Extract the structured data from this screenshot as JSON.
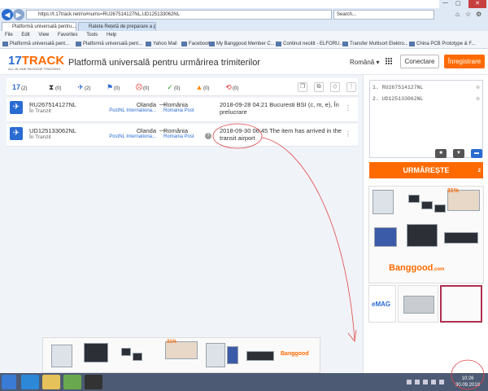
{
  "browser": {
    "url": "https://t.17track.net/ro#nums=RU267514127NL,UD125133062NL",
    "search_placeholder": "Search...",
    "tabs": [
      "Platformă universală pentru...",
      "Rateta Rețetă de preparare a pa..."
    ],
    "menu": [
      "File",
      "Edit",
      "View",
      "Favorites",
      "Tools",
      "Help"
    ],
    "favorites": [
      "Platformă universală pent...",
      "Platformă universală pent...",
      "Yahoo Mail",
      "Facebook",
      "My Banggood Member C...",
      "Continut necitit - ELFORU...",
      "Transfer Multisort Elektro...",
      "China PCB Prototype & F..."
    ]
  },
  "header": {
    "logo_text": "17",
    "logo_text2": "TRACK",
    "logo_sub": "ALL-IN-ONE PACKAGE TRACKING",
    "title": "Platformă universală pentru urmărirea trimiterilor",
    "language": "Română ▾",
    "login": "Conectare",
    "register": "Înregistrare"
  },
  "filters": [
    {
      "icon": "17",
      "count": "(2)",
      "color": "#2a6bd1"
    },
    {
      "icon": "⧗",
      "count": "(0)",
      "color": "#666666"
    },
    {
      "icon": "✈",
      "count": "(2)",
      "color": "#2a6bd1"
    },
    {
      "icon": "⚑",
      "count": "(0)",
      "color": "#2a6bd1"
    },
    {
      "icon": "☹",
      "count": "(0)",
      "color": "#e03030"
    },
    {
      "icon": "✓",
      "count": "(0)",
      "color": "#2aa02a"
    },
    {
      "icon": "▲",
      "count": "(0)",
      "color": "#ff8a00"
    },
    {
      "icon": "⟲",
      "count": "(0)",
      "color": "#e03030"
    }
  ],
  "tools": [
    "copy-icon",
    "copy-alt-icon",
    "refresh-icon",
    "more-icon"
  ],
  "packages": [
    {
      "number": "RU267514127NL",
      "status": "În Tranzit",
      "from_country": "Olanda",
      "from_carrier": "PostNL Internationa...",
      "to_country": "România",
      "to_carrier": "Romania Post",
      "event": "2018-09-28 04:21  Bucuresti BSI (c, m, e), În prelucrare"
    },
    {
      "number": "UD125133062NL",
      "status": "În Tranzit",
      "from_country": "Olanda",
      "from_carrier": "PostNL Internationa...",
      "to_country": "România",
      "to_carrier": "Romania Post",
      "event": "2018-09-30 06:45  The item has arrived in the transit airport"
    }
  ],
  "track_panel": {
    "lines": [
      "1.  RU267514127NL",
      "2.  UD125133062NL"
    ],
    "button": "URMĂREȘTE",
    "count": "2"
  },
  "ads": {
    "banggood": "Banggood",
    "banggood_sub": ".com",
    "emag": "eMAG",
    "badge": "31%"
  },
  "taskbar": {
    "time": "10:26",
    "date": "30.09.2018"
  }
}
